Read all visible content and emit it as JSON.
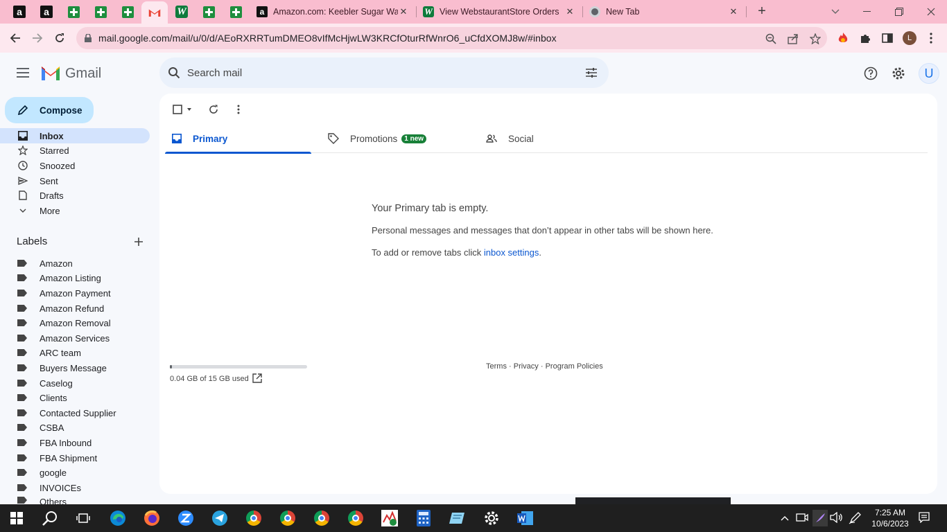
{
  "browser": {
    "tabs": [
      {
        "title": "Amazon.com: Keebler Sugar Wafer"
      },
      {
        "title": "View WebstaurantStore Orders"
      },
      {
        "title": "New Tab"
      }
    ],
    "close_glyph": "✕",
    "new_tab_glyph": "+",
    "url": "mail.google.com/mail/u/0/d/AEoRXRRTumDMEO8vIfMcHjwLW3KRCfOturRfWnrO6_uCfdXOMJ8w/#inbox",
    "profile_initial": "L",
    "accent_color": "#f9bdcf"
  },
  "gmail": {
    "brand": "Gmail",
    "search_placeholder": "Search mail",
    "account_initial": "U",
    "compose_label": "Compose",
    "nav": [
      {
        "label": "Inbox",
        "icon": "inbox-icon",
        "active": true
      },
      {
        "label": "Starred",
        "icon": "star-icon"
      },
      {
        "label": "Snoozed",
        "icon": "clock-icon"
      },
      {
        "label": "Sent",
        "icon": "send-icon"
      },
      {
        "label": "Drafts",
        "icon": "draft-icon"
      },
      {
        "label": "More",
        "icon": "chevron-down-icon"
      }
    ],
    "labels_title": "Labels",
    "labels": [
      "Amazon",
      "Amazon Listing",
      "Amazon Payment",
      "Amazon Refund",
      "Amazon Removal",
      "Amazon Services",
      "ARC team",
      "Buyers Message",
      "Caselog",
      "Clients",
      "Contacted Supplier",
      "CSBA",
      "FBA Inbound",
      "FBA Shipment",
      "google",
      "INVOICEs",
      "Others"
    ],
    "tabs": [
      {
        "label": "Primary",
        "icon": "inbox-icon",
        "active": true
      },
      {
        "label": "Promotions",
        "icon": "tag-icon",
        "badge": "1 new"
      },
      {
        "label": "Social",
        "icon": "people-icon"
      }
    ],
    "empty": {
      "title": "Your Primary tab is empty.",
      "description": "Personal messages and messages that don’t appear in other tabs will be shown here.",
      "settings_prefix": "To add or remove tabs click ",
      "settings_link": "inbox settings",
      "settings_suffix": "."
    },
    "storage": {
      "text": "0.04 GB of 15 GB used",
      "fraction_used": 0.003
    },
    "footer": {
      "terms": "Terms",
      "separator": " · ",
      "privacy": "Privacy",
      "policies": "Program Policies"
    }
  },
  "taskbar": {
    "time": "7:25 AM",
    "date": "10/6/2023"
  }
}
